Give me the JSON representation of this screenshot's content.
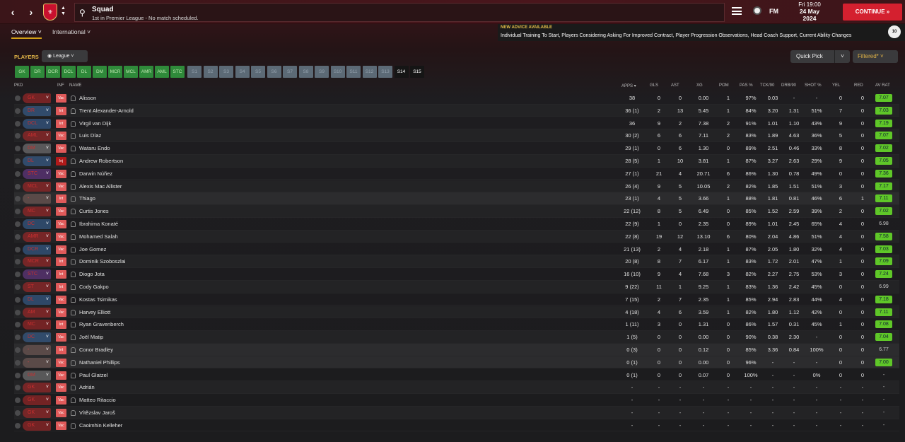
{
  "header": {
    "title": "Squad",
    "subtitle": "1st in Premier League - No match scheduled.",
    "date_day": "Fri 19:00",
    "date_full": "24 May",
    "date_year": "2024",
    "continue_label": "CONTINUE",
    "fm_label": "FM"
  },
  "tabs": [
    {
      "label": "Overview"
    },
    {
      "label": "International"
    }
  ],
  "advice": {
    "heading": "NEW ADVICE AVAILABLE",
    "body": "Individual Training To Start, Players Considering Asking For Improved Contract, Player Progression Observations, Head Coach Support, Current Ability Changes",
    "count": "10"
  },
  "controls": {
    "players_label": "PLAYERS",
    "scope": "League",
    "quick_pick": "Quick Pick",
    "filter": "Filtered*"
  },
  "position_chips": [
    "GK",
    "DR",
    "DCR",
    "DCL",
    "DL",
    "DM",
    "MCR",
    "MCL",
    "AMR",
    "AML",
    "STC"
  ],
  "set_chips": [
    "S1",
    "S2",
    "S3",
    "S4",
    "S5",
    "S6",
    "S7",
    "S8",
    "S9",
    "S10",
    "S11",
    "S12",
    "S13",
    "S14",
    "S15"
  ],
  "columns": {
    "pkd": "PKD",
    "inf": "INF",
    "name": "NAME",
    "apps": "APPS",
    "gls": "GLS",
    "ast": "AST",
    "xg": "XG",
    "pom": "POM",
    "pas": "PAS %",
    "tck": "TCK/90",
    "drb": "DRB/90",
    "shot": "SHOT %",
    "yel": "YEL",
    "red": "RED",
    "avrat": "AV RAT"
  },
  "players": [
    {
      "pos": "GK",
      "inf": "Vac",
      "name": "Alisson",
      "apps": "38",
      "gls": "0",
      "ast": "0",
      "xg": "0.00",
      "pom": "1",
      "pas": "97%",
      "tck": "0.03",
      "drb": "-",
      "shot": "-",
      "yel": "0",
      "red": "0",
      "rat": "7.07",
      "g": true
    },
    {
      "pos": "DR",
      "inf": "Int",
      "name": "Trent Alexander-Arnold",
      "apps": "36 (1)",
      "gls": "2",
      "ast": "13",
      "xg": "5.45",
      "pom": "1",
      "pas": "84%",
      "tck": "3.20",
      "drb": "1.31",
      "shot": "51%",
      "yel": "7",
      "red": "0",
      "rat": "7.03",
      "g": true
    },
    {
      "pos": "DCL",
      "inf": "Int",
      "name": "Virgil van Dijk",
      "apps": "36",
      "gls": "9",
      "ast": "2",
      "xg": "7.38",
      "pom": "2",
      "pas": "91%",
      "tck": "1.01",
      "drb": "1.10",
      "shot": "43%",
      "yel": "9",
      "red": "0",
      "rat": "7.19",
      "g": true
    },
    {
      "pos": "AML",
      "inf": "Vac",
      "name": "Luis Díaz",
      "apps": "30 (2)",
      "gls": "6",
      "ast": "6",
      "xg": "7.11",
      "pom": "2",
      "pas": "83%",
      "tck": "1.89",
      "drb": "4.63",
      "shot": "36%",
      "yel": "5",
      "red": "0",
      "rat": "7.07",
      "g": true
    },
    {
      "pos": "DM",
      "inf": "Vac",
      "name": "Wataru Endo",
      "apps": "29 (1)",
      "gls": "0",
      "ast": "6",
      "xg": "1.30",
      "pom": "0",
      "pas": "89%",
      "tck": "2.51",
      "drb": "0.46",
      "shot": "33%",
      "yel": "8",
      "red": "0",
      "rat": "7.02",
      "g": true
    },
    {
      "pos": "DL",
      "inf": "Inj",
      "name": "Andrew Robertson",
      "apps": "28 (5)",
      "gls": "1",
      "ast": "10",
      "xg": "3.81",
      "pom": "1",
      "pas": "87%",
      "tck": "3.27",
      "drb": "2.63",
      "shot": "29%",
      "yel": "9",
      "red": "0",
      "rat": "7.05",
      "g": true
    },
    {
      "pos": "STC",
      "inf": "Vac",
      "name": "Darwin Núñez",
      "apps": "27 (1)",
      "gls": "21",
      "ast": "4",
      "xg": "20.71",
      "pom": "6",
      "pas": "86%",
      "tck": "1.30",
      "drb": "0.78",
      "shot": "49%",
      "yel": "0",
      "red": "0",
      "rat": "7.36",
      "g": true
    },
    {
      "pos": "MCL",
      "inf": "Vac",
      "name": "Alexis Mac Allister",
      "apps": "26 (4)",
      "gls": "9",
      "ast": "5",
      "xg": "10.05",
      "pom": "2",
      "pas": "82%",
      "tck": "1.85",
      "drb": "1.51",
      "shot": "51%",
      "yel": "3",
      "red": "0",
      "rat": "7.17",
      "g": true
    },
    {
      "pos": "-",
      "inf": "Int",
      "name": "Thiago",
      "apps": "23 (1)",
      "gls": "4",
      "ast": "5",
      "xg": "3.66",
      "pom": "1",
      "pas": "88%",
      "tck": "1.81",
      "drb": "0.81",
      "shot": "46%",
      "yel": "6",
      "red": "1",
      "rat": "7.11",
      "g": true
    },
    {
      "pos": "MC",
      "inf": "Vac",
      "name": "Curtis Jones",
      "apps": "22 (12)",
      "gls": "8",
      "ast": "5",
      "xg": "6.49",
      "pom": "0",
      "pas": "85%",
      "tck": "1.52",
      "drb": "2.59",
      "shot": "39%",
      "yel": "2",
      "red": "0",
      "rat": "7.02",
      "g": true
    },
    {
      "pos": "DC",
      "inf": "Vac",
      "name": "Ibrahima Konaté",
      "apps": "22 (9)",
      "gls": "1",
      "ast": "0",
      "xg": "2.35",
      "pom": "0",
      "pas": "89%",
      "tck": "1.01",
      "drb": "2.45",
      "shot": "65%",
      "yel": "4",
      "red": "0",
      "rat": "6.98",
      "g": false
    },
    {
      "pos": "AMR",
      "inf": "Vac",
      "name": "Mohamed Salah",
      "apps": "22 (8)",
      "gls": "19",
      "ast": "12",
      "xg": "13.10",
      "pom": "6",
      "pas": "80%",
      "tck": "2.04",
      "drb": "4.86",
      "shot": "51%",
      "yel": "4",
      "red": "0",
      "rat": "7.58",
      "g": true
    },
    {
      "pos": "DCR",
      "inf": "Vac",
      "name": "Joe Gomez",
      "apps": "21 (13)",
      "gls": "2",
      "ast": "4",
      "xg": "2.18",
      "pom": "1",
      "pas": "87%",
      "tck": "2.05",
      "drb": "1.80",
      "shot": "32%",
      "yel": "4",
      "red": "0",
      "rat": "7.03",
      "g": true
    },
    {
      "pos": "MCR",
      "inf": "Int",
      "name": "Dominik Szoboszlai",
      "apps": "20 (8)",
      "gls": "8",
      "ast": "7",
      "xg": "6.17",
      "pom": "1",
      "pas": "83%",
      "tck": "1.72",
      "drb": "2.01",
      "shot": "47%",
      "yel": "1",
      "red": "0",
      "rat": "7.09",
      "g": true
    },
    {
      "pos": "STC",
      "inf": "Int",
      "name": "Diogo Jota",
      "apps": "16 (10)",
      "gls": "9",
      "ast": "4",
      "xg": "7.68",
      "pom": "3",
      "pas": "82%",
      "tck": "2.27",
      "drb": "2.75",
      "shot": "53%",
      "yel": "3",
      "red": "0",
      "rat": "7.24",
      "g": true
    },
    {
      "pos": "ST",
      "inf": "Int",
      "name": "Cody Gakpo",
      "apps": "9 (22)",
      "gls": "11",
      "ast": "1",
      "xg": "9.25",
      "pom": "1",
      "pas": "83%",
      "tck": "1.36",
      "drb": "2.42",
      "shot": "45%",
      "yel": "0",
      "red": "0",
      "rat": "6.99",
      "g": false
    },
    {
      "pos": "DL",
      "inf": "Vac",
      "name": "Kostas Tsimikas",
      "apps": "7 (15)",
      "gls": "2",
      "ast": "7",
      "xg": "2.35",
      "pom": "1",
      "pas": "85%",
      "tck": "2.94",
      "drb": "2.83",
      "shot": "44%",
      "yel": "4",
      "red": "0",
      "rat": "7.18",
      "g": true
    },
    {
      "pos": "AM",
      "inf": "Vac",
      "name": "Harvey Elliott",
      "apps": "4 (18)",
      "gls": "4",
      "ast": "6",
      "xg": "3.59",
      "pom": "1",
      "pas": "82%",
      "tck": "1.80",
      "drb": "1.12",
      "shot": "42%",
      "yel": "0",
      "red": "0",
      "rat": "7.11",
      "g": true
    },
    {
      "pos": "MC",
      "inf": "Int",
      "name": "Ryan Gravenberch",
      "apps": "1 (11)",
      "gls": "3",
      "ast": "0",
      "xg": "1.31",
      "pom": "0",
      "pas": "86%",
      "tck": "1.57",
      "drb": "0.31",
      "shot": "45%",
      "yel": "1",
      "red": "0",
      "rat": "7.08",
      "g": true
    },
    {
      "pos": "DC",
      "inf": "Vac",
      "name": "Joël Matip",
      "apps": "1 (5)",
      "gls": "0",
      "ast": "0",
      "xg": "0.00",
      "pom": "0",
      "pas": "90%",
      "tck": "0.38",
      "drb": "2.30",
      "shot": "-",
      "yel": "0",
      "red": "0",
      "rat": "7.04",
      "g": true
    },
    {
      "pos": "-",
      "inf": "Int",
      "name": "Conor Bradley",
      "apps": "0 (3)",
      "gls": "0",
      "ast": "0",
      "xg": "0.12",
      "pom": "0",
      "pas": "85%",
      "tck": "3.36",
      "drb": "0.84",
      "shot": "100%",
      "yel": "0",
      "red": "0",
      "rat": "6.77",
      "g": false
    },
    {
      "pos": "-",
      "inf": "Vac",
      "name": "Nathaniel Phillips",
      "apps": "0 (1)",
      "gls": "0",
      "ast": "0",
      "xg": "0.00",
      "pom": "0",
      "pas": "96%",
      "tck": "-",
      "drb": "-",
      "shot": "-",
      "yel": "0",
      "red": "0",
      "rat": "7.00",
      "g": true
    },
    {
      "pos": "DM",
      "inf": "Vac",
      "name": "Paul Glatzel",
      "apps": "0 (1)",
      "gls": "0",
      "ast": "0",
      "xg": "0.07",
      "pom": "0",
      "pas": "100%",
      "tck": "-",
      "drb": "-",
      "shot": "0%",
      "yel": "0",
      "red": "0",
      "rat": "-",
      "g": false
    },
    {
      "pos": "GK",
      "inf": "Vac",
      "name": "Adrián",
      "apps": "-",
      "gls": "-",
      "ast": "-",
      "xg": "-",
      "pom": "-",
      "pas": "-",
      "tck": "-",
      "drb": "-",
      "shot": "-",
      "yel": "-",
      "red": "-",
      "rat": "-",
      "g": false
    },
    {
      "pos": "GK",
      "inf": "Vac",
      "name": "Matteo Ritaccio",
      "apps": "-",
      "gls": "-",
      "ast": "-",
      "xg": "-",
      "pom": "-",
      "pas": "-",
      "tck": "-",
      "drb": "-",
      "shot": "-",
      "yel": "-",
      "red": "-",
      "rat": "-",
      "g": false
    },
    {
      "pos": "GK",
      "inf": "Vac",
      "name": "Vítězslav Jaroš",
      "apps": "-",
      "gls": "-",
      "ast": "-",
      "xg": "-",
      "pom": "-",
      "pas": "-",
      "tck": "-",
      "drb": "-",
      "shot": "-",
      "yel": "-",
      "red": "-",
      "rat": "-",
      "g": false
    },
    {
      "pos": "GK",
      "inf": "Vac",
      "name": "Caoimhin Kelleher",
      "apps": "-",
      "gls": "-",
      "ast": "-",
      "xg": "-",
      "pom": "-",
      "pas": "-",
      "tck": "-",
      "drb": "-",
      "shot": "-",
      "yel": "-",
      "red": "-",
      "rat": "-",
      "g": false
    }
  ]
}
